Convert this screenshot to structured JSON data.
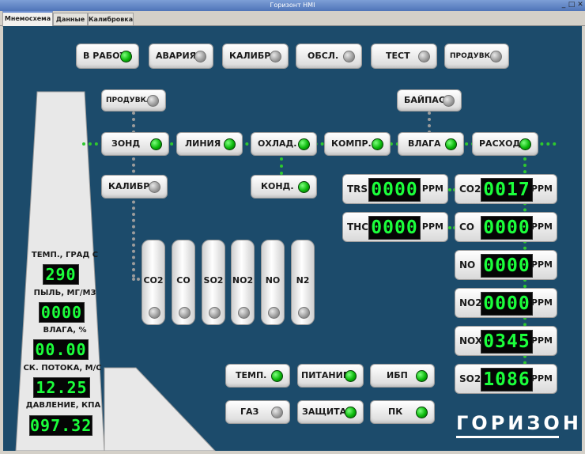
{
  "window": {
    "title": "Горизонт HMI",
    "controls": [
      "_",
      "□",
      "✕"
    ]
  },
  "tabs": [
    {
      "label": "Мнемосхема",
      "active": true
    },
    {
      "label": "Данные",
      "active": false
    },
    {
      "label": "Калибровка",
      "active": false
    }
  ],
  "status_buttons": [
    {
      "label": "В РАБОТЕ",
      "led": "on"
    },
    {
      "label": "АВАРИЯ",
      "led": "off"
    },
    {
      "label": "КАЛИБР.",
      "led": "off"
    },
    {
      "label": "ОБСЛ.",
      "led": "off"
    },
    {
      "label": "ТЕСТ",
      "led": "off"
    },
    {
      "label": "ПРОДУВКА",
      "led": "off"
    }
  ],
  "flow": {
    "purge": {
      "label": "ПРОДУВКА",
      "led": "off"
    },
    "bypass": {
      "label": "БАЙПАС",
      "led": "off"
    },
    "probe": {
      "label": "ЗОНД",
      "led": "on"
    },
    "line": {
      "label": "ЛИНИЯ",
      "led": "on"
    },
    "cooling": {
      "label": "ОХЛАД.",
      "led": "on"
    },
    "compressor": {
      "label": "КОМПР.",
      "led": "on"
    },
    "humidity": {
      "label": "ВЛАГА",
      "led": "on"
    },
    "flowrate": {
      "label": "РАСХОД",
      "led": "on"
    },
    "calibration": {
      "label": "КАЛИБР.",
      "led": "off"
    },
    "condensate": {
      "label": "КОНД.",
      "led": "on"
    }
  },
  "cylinders": [
    {
      "label": "CO2",
      "led": "off"
    },
    {
      "label": "CO",
      "led": "off"
    },
    {
      "label": "SO2",
      "led": "off"
    },
    {
      "label": "NO2",
      "led": "off"
    },
    {
      "label": "NO",
      "led": "off"
    },
    {
      "label": "N2",
      "led": "off"
    }
  ],
  "meters_left": [
    {
      "label": "TRS",
      "value": "0000",
      "unit": "PPM"
    },
    {
      "label": "THC",
      "value": "0000",
      "unit": "PPM"
    }
  ],
  "meters_right": [
    {
      "label": "CO2",
      "value": "0017",
      "unit": "PPM"
    },
    {
      "label": "CO",
      "value": "0000",
      "unit": "PPM"
    },
    {
      "label": "NO",
      "value": "0000",
      "unit": "PPM"
    },
    {
      "label": "NO2",
      "value": "0000",
      "unit": "PPM"
    },
    {
      "label": "NOX",
      "value": "0345",
      "unit": "PPM"
    },
    {
      "label": "SO2",
      "value": "1086",
      "unit": "PPM"
    }
  ],
  "stack": [
    {
      "label": "ТЕМП., ГРАД С",
      "value": "290"
    },
    {
      "label": "ПЫЛЬ, МГ/М3",
      "value": "0000"
    },
    {
      "label": "ВЛАГА, %",
      "value": "00.00"
    },
    {
      "label": "СК. ПОТОКА, М/С",
      "value": "12.25"
    },
    {
      "label": "ДАВЛЕНИЕ, КПА",
      "value": "097.32"
    }
  ],
  "system_buttons": [
    {
      "label": "ТЕМП.",
      "led": "on"
    },
    {
      "label": "ПИТАНИЕ",
      "led": "on"
    },
    {
      "label": "ИБП",
      "led": "on"
    },
    {
      "label": "ГАЗ",
      "led": "off"
    },
    {
      "label": "ЗАЩИТА",
      "led": "on"
    },
    {
      "label": "ПК",
      "led": "on"
    }
  ],
  "logo": "ГОРИЗОНТ",
  "colors": {
    "background": "#1c4b6b",
    "led_on": "#0bb80b",
    "led_off": "#9a9a9a",
    "display_text": "#1bff3b",
    "pipe": "#2ec82e"
  }
}
